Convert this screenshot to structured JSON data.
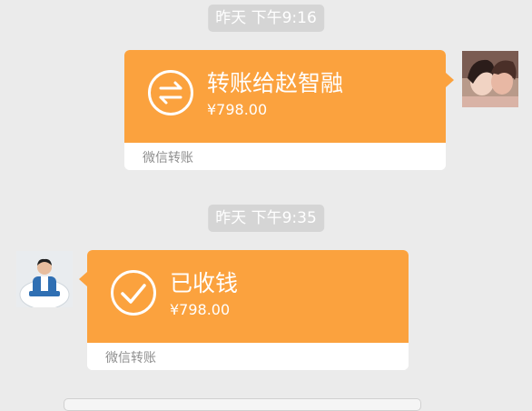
{
  "messages": [
    {
      "timestamp": "昨天 下午9:16",
      "direction": "outgoing",
      "avatar": "avatar-couple",
      "card": {
        "icon": "transfer-arrows-icon",
        "title": "转账给赵智融",
        "amount": "¥798.00",
        "footer": "微信转账"
      }
    },
    {
      "timestamp": "昨天 下午9:35",
      "direction": "incoming",
      "avatar": "avatar-man-in-suit",
      "card": {
        "icon": "checkmark-circle-icon",
        "title": "已收钱",
        "amount": "¥798.00",
        "footer": "微信转账"
      }
    }
  ],
  "colors": {
    "background": "#ebebeb",
    "card_orange": "#fba23e",
    "timestamp_bg": "#d5d5d5",
    "footer_text": "#8f8f8f"
  }
}
